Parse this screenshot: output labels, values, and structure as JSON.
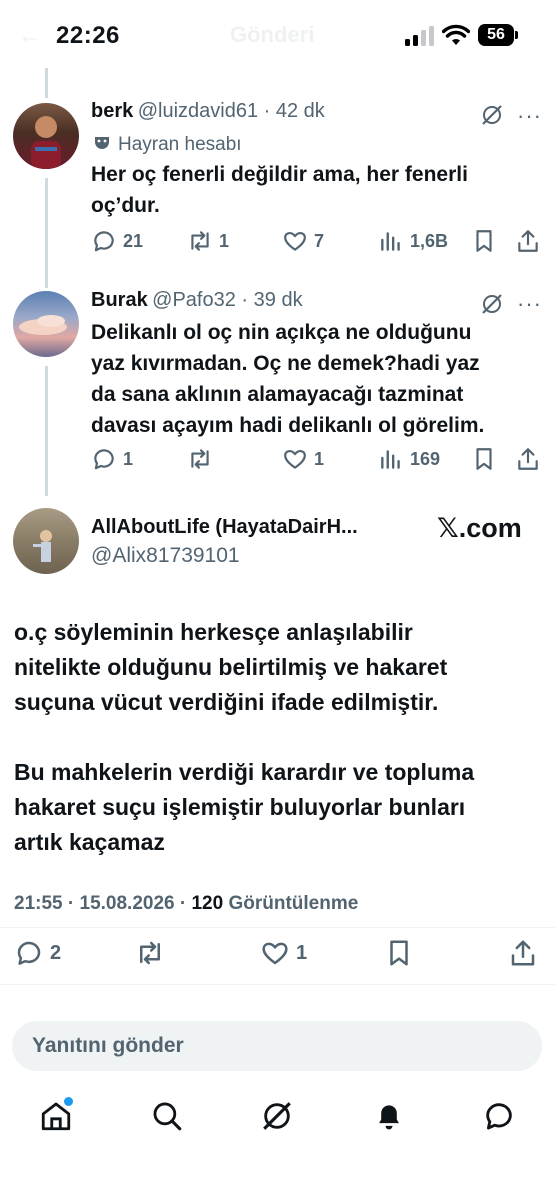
{
  "status_bar": {
    "time": "22:26",
    "battery": "56"
  },
  "header": {
    "title": "Gönderi"
  },
  "tweets": [
    {
      "name": "berk",
      "handle": "@luizdavid61",
      "time": "42 dk",
      "badge": "Hayran hesabı",
      "text_lines": [
        "Her oç fenerli değildir ama, her fenerli",
        "oç’dur."
      ],
      "replies": "21",
      "reposts": "1",
      "likes": "7",
      "views": "1,6B"
    },
    {
      "name": "Burak",
      "handle": "@Pafo32",
      "time": "39 dk",
      "text_lines": [
        "Delikanlı ol oç nin açıkça ne olduğunu",
        "yaz kıvırmadan. Oç ne demek?hadi yaz",
        "da sana aklının alamayacağı tazminat",
        "davası açayım hadi delikanlı ol görelim."
      ],
      "replies": "1",
      "reposts": "",
      "likes": "1",
      "views": "169"
    }
  ],
  "main_tweet": {
    "name": "AllAboutLife (HayataDairH...",
    "handle": "@Alix81739101",
    "watermark": "𝕏.com",
    "paragraph1": [
      "o.ç söyleminin herkesçe anlaşılabilir",
      "nitelikte olduğunu belirtilmiş ve hakaret",
      "suçuna vücut verdiğini ifade edilmiştir."
    ],
    "paragraph2": [
      "Bu mahkelerin verdiği karardır ve topluma",
      "hakaret suçu işlemiştir buluyorlar bunları",
      "artık kaçamaz"
    ],
    "time": "21:55",
    "date": "15.08.2026",
    "views": "120",
    "views_label": "Görüntülenme",
    "replies": "2",
    "likes": "1"
  },
  "reply": {
    "placeholder": "Yanıtını gönder"
  },
  "bottom_nav": {
    "items": [
      "home-icon",
      "search-icon",
      "grok-icon",
      "notifications-icon",
      "messages-icon"
    ]
  },
  "colors": {
    "text": "#0f1419",
    "secondary": "#536471",
    "accent": "#1d9bf0"
  }
}
